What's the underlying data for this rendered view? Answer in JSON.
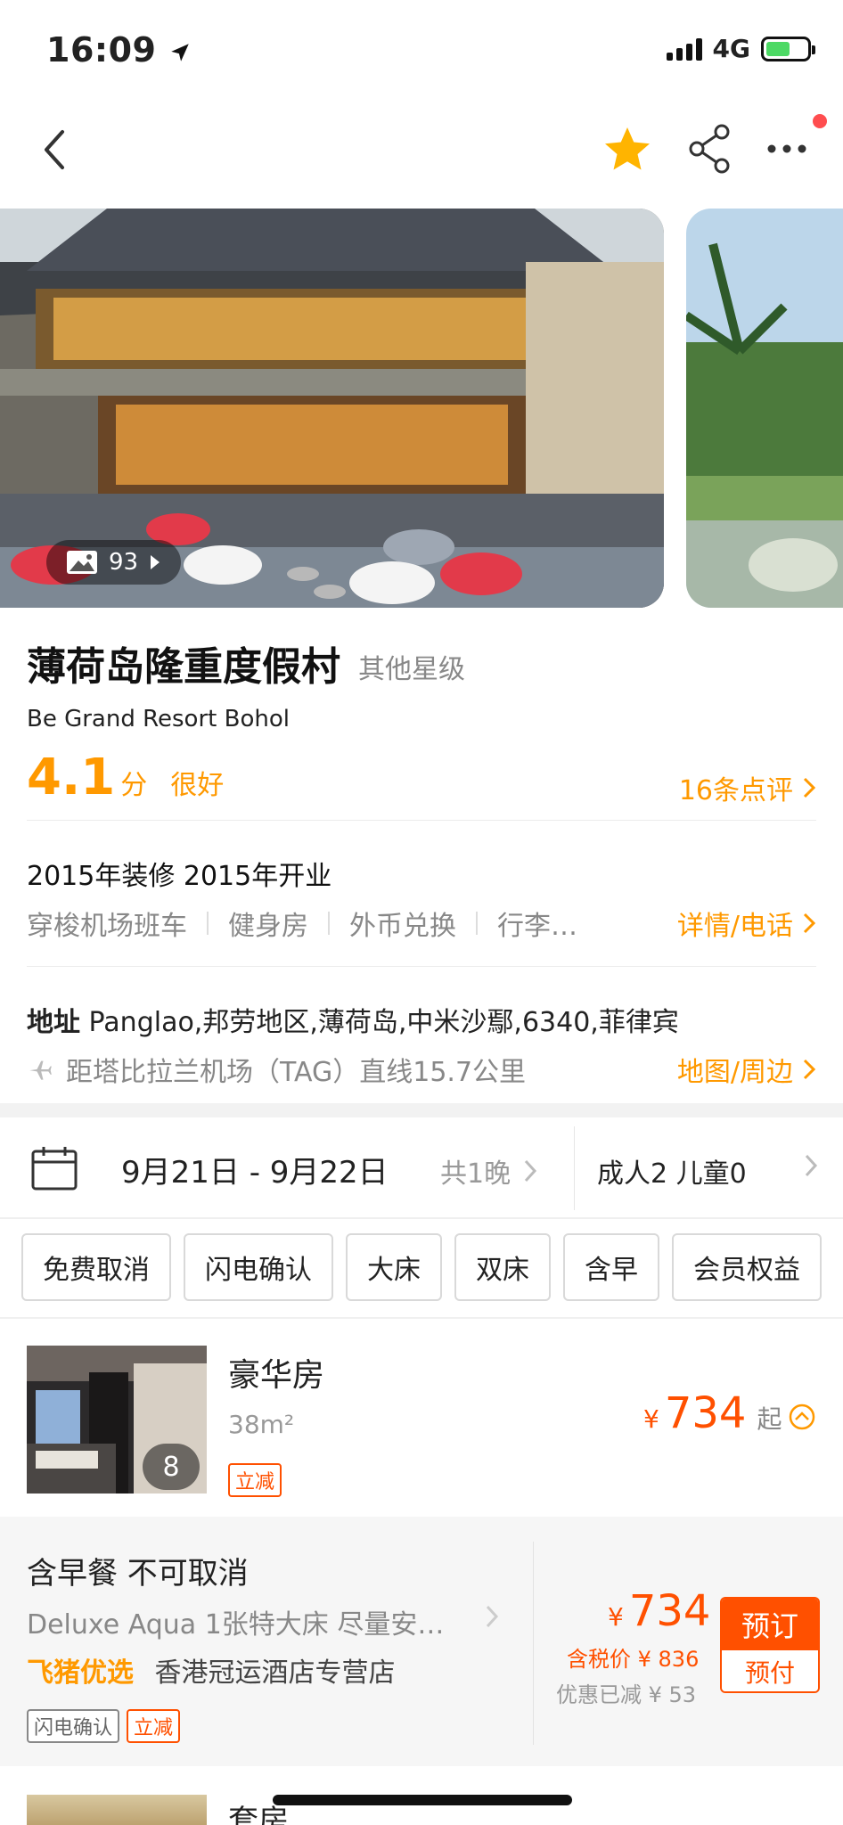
{
  "status_bar": {
    "time": "16:09",
    "network": "4G"
  },
  "nav": {
    "back_icon": "chevron-left-icon",
    "favorite_icon": "star-icon",
    "share_icon": "share-icon",
    "more_icon": "more-icon",
    "accent": "#ffb400"
  },
  "gallery": {
    "photo_count": "93"
  },
  "hotel": {
    "name": "薄荷岛隆重度假村",
    "star_level": "其他星级",
    "name_en": "Be Grand Resort Bohol",
    "score": "4.1",
    "score_unit": "分",
    "rating_word": "很好",
    "reviews_link": "16条点评",
    "renovation": "2015年装修 2015年开业",
    "facilities": [
      "穿梭机场班车",
      "健身房",
      "外币兑换",
      "行李…"
    ],
    "detail_link": "详情/电话",
    "address_label": "地址",
    "address": "Panglao,邦劳地区,薄荷岛,中米沙鄢,6340,菲律宾",
    "airport_distance": "距塔比拉兰机场（TAG）直线15.7公里",
    "map_link": "地图/周边"
  },
  "booking_bar": {
    "dates": "9月21日 - 9月22日",
    "nights": "共1晚",
    "guests": "成人2 儿童0"
  },
  "filters": [
    "免费取消",
    "闪电确认",
    "大床",
    "双床",
    "含早",
    "会员权益"
  ],
  "room": {
    "name": "豪华房",
    "size": "38m²",
    "photo_count": "8",
    "tag": "立减",
    "currency": "¥",
    "price": "734",
    "price_suffix": "起"
  },
  "rate_plan": {
    "title": "含早餐 不可取消",
    "description": "Deluxe Aqua 1张特大床 尽量安…",
    "brand": "飞猪优选",
    "vendor": "香港冠运酒店专营店",
    "tags": [
      "闪电确认",
      "立减"
    ],
    "currency": "¥",
    "price": "734",
    "tax_price": "含税价 ¥ 836",
    "discount": "优惠已减 ¥ 53",
    "book_label": "预订",
    "pay_label": "预付"
  },
  "next_room": {
    "name": "套房"
  },
  "colors": {
    "orange": "#ff9900",
    "price_red": "#ff5000",
    "text": "#222222",
    "muted": "#888888"
  }
}
